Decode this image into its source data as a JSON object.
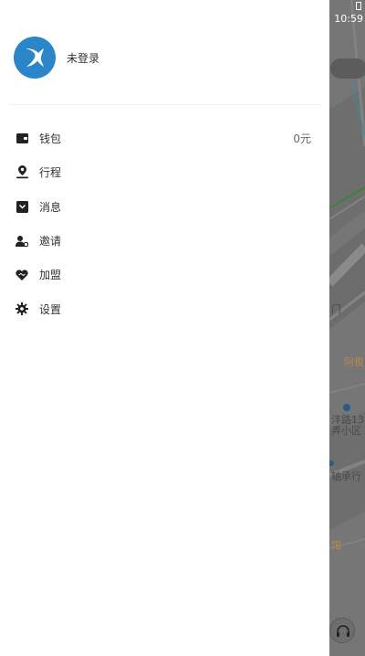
{
  "status_bar": {
    "time": "10:59"
  },
  "user": {
    "login_status": "未登录"
  },
  "menu": {
    "items": [
      {
        "id": "wallet",
        "label": "钱包",
        "value": "0元",
        "icon": "wallet-icon"
      },
      {
        "id": "trips",
        "label": "行程",
        "icon": "location-pin-icon"
      },
      {
        "id": "messages",
        "label": "消息",
        "icon": "message-icon"
      },
      {
        "id": "invite",
        "label": "邀请",
        "icon": "invite-user-icon"
      },
      {
        "id": "join",
        "label": "加盟",
        "icon": "handshake-heart-icon"
      },
      {
        "id": "settings",
        "label": "设置",
        "icon": "gear-icon"
      }
    ]
  },
  "map": {
    "labels": [
      "门",
      "阿俊",
      "沣路13",
      "弄小区",
      "轴承行",
      "馆"
    ]
  },
  "colors": {
    "accent": "#2b86c9",
    "icon": "#222222",
    "drawer_bg": "#ffffff",
    "overlay": "#767676"
  }
}
